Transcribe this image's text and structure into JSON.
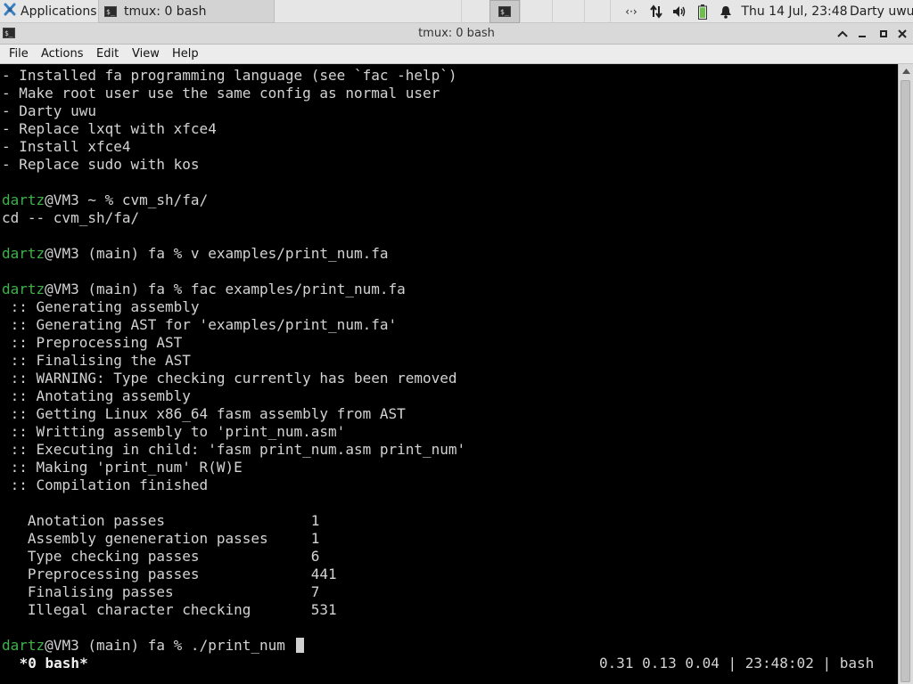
{
  "panel": {
    "applications_label": "Applications",
    "taskbar_item": "tmux: 0 bash",
    "clock": "Thu 14 Jul, 23:48",
    "user": "Darty uwu",
    "network_glyph": "‹·›"
  },
  "window": {
    "title": "tmux: 0 bash",
    "icon_glyph": "$_"
  },
  "menu": {
    "file": "File",
    "actions": "Actions",
    "edit": "Edit",
    "view": "View",
    "help": "Help"
  },
  "terminal": {
    "lines": [
      "- Installed fa programming language (see `fac -help`)",
      "- Make root user use the same config as normal user",
      "- Darty uwu",
      "- Replace lxqt with xfce4",
      "- Install xfce4",
      "- Replace sudo with kos",
      "",
      "dartz@VM3 ~ % cvm_sh/fa/",
      "cd -- cvm_sh/fa/",
      "",
      "dartz@VM3 (main) fa % v examples/print_num.fa",
      "",
      "dartz@VM3 (main) fa % fac examples/print_num.fa",
      " :: Generating assembly",
      " :: Generating AST for 'examples/print_num.fa'",
      " :: Preprocessing AST",
      " :: Finalising the AST",
      " :: WARNING: Type checking currently has been removed",
      " :: Anotating assembly",
      " :: Getting Linux x86_64 fasm assembly from AST",
      " :: Writting assembly to 'print_num.asm'",
      " :: Executing in child: 'fasm print_num.asm print_num'",
      " :: Making 'print_num' R(W)E",
      " :: Compilation finished",
      "",
      "   Anotation passes                 1",
      "   Assembly geneneration passes     1",
      "   Type checking passes             6",
      "   Preprocessing passes             441",
      "   Finalising passes                7",
      "   Illegal character checking       531",
      "",
      "dartz@VM3 (main) fa % ./print_num "
    ],
    "prompt_user": "dartz",
    "status_left": " *0 bash*",
    "status_right": "0.31 0.13 0.04 | 23:48:02 | bash"
  },
  "colors": {
    "prompt_green": "#3fb14a",
    "terminal_bg": "#000000",
    "terminal_fg": "#d3d3d3"
  },
  "icons": {
    "apps": "xfce-mouse-icon",
    "terminal": "terminal-icon",
    "network": "network-icon",
    "transfer": "up-down-arrows-icon",
    "volume": "speaker-icon",
    "battery": "battery-icon",
    "notifications": "bell-icon"
  }
}
